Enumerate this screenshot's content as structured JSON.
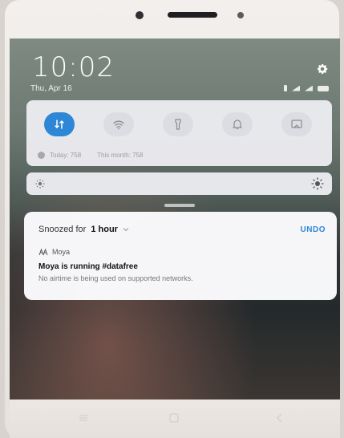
{
  "lockscreen": {
    "time": "10:02",
    "date": "Thu, Apr 16"
  },
  "status_bar": {
    "icons": [
      "bluetooth-icon",
      "signal-icon",
      "signal-icon",
      "battery-icon"
    ]
  },
  "quick_settings": {
    "toggles": [
      {
        "icon": "mobile-data-icon",
        "active": true
      },
      {
        "icon": "wifi-icon",
        "active": false
      },
      {
        "icon": "flashlight-icon",
        "active": false
      },
      {
        "icon": "bell-icon",
        "active": false
      },
      {
        "icon": "screen-cast-icon",
        "active": false
      }
    ],
    "data_today": "Today: 758",
    "data_month": "This month: 758"
  },
  "notification": {
    "snooze_prefix": "Snoozed for",
    "snooze_duration": "1 hour",
    "undo_label": "UNDO",
    "app_name": "Moya",
    "title": "Moya is running #datafree",
    "body": "No airtime is being used on supported networks."
  },
  "colors": {
    "accent": "#2d86d6"
  }
}
